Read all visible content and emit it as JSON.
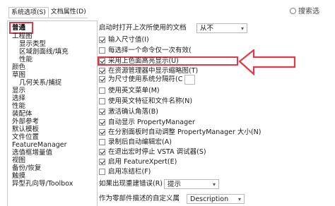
{
  "tabs": [
    {
      "label": "系统选项(S)"
    },
    {
      "label": "文档属性(D)"
    }
  ],
  "search": {
    "placeholder": "搜索选"
  },
  "sidebar": {
    "selected": "普通",
    "items": [
      {
        "label": "工程图",
        "level": 1
      },
      {
        "label": "显示类型",
        "level": 2
      },
      {
        "label": "区域剖面线/填充",
        "level": 2
      },
      {
        "label": "性能",
        "level": 2
      },
      {
        "label": "颜色",
        "level": 1
      },
      {
        "label": "草图",
        "level": 1
      },
      {
        "label": "几何关系/捕捉",
        "level": 2
      },
      {
        "label": "显示",
        "level": 1
      },
      {
        "label": "选择",
        "level": 1
      },
      {
        "label": "性能",
        "level": 1
      },
      {
        "label": "装配体",
        "level": 1
      },
      {
        "label": "外部参考",
        "level": 1
      },
      {
        "label": "默认模板",
        "level": 1
      },
      {
        "label": "文件位置",
        "level": 1
      },
      {
        "label": "FeatureManager",
        "level": 1
      },
      {
        "label": "选值框增量值",
        "level": 1
      },
      {
        "label": "视图",
        "level": 1
      },
      {
        "label": "备份/恢复",
        "level": 1
      },
      {
        "label": "触摸",
        "level": 1
      },
      {
        "label": "异型孔向导/Toolbox",
        "level": 1
      }
    ]
  },
  "settings": {
    "startup_label": "启动时打开上次所使用的文档",
    "startup_value": "从不",
    "options": [
      {
        "label": "输入尺寸值(I)",
        "checked": true
      },
      {
        "label": "每选择一个命令仅一次有效(",
        "checked": false
      },
      {
        "label": "采用上色面高亮显示(U)",
        "checked": true
      },
      {
        "label": "在资源管理器中显示缩略图(T)",
        "checked": true
      },
      {
        "label": "为尺寸使用系统分隔符(C",
        "checked": true
      },
      {
        "label": "使用英文菜单(M)",
        "checked": false
      },
      {
        "label": "使用英文特征和文件名称(N)",
        "checked": false
      },
      {
        "label": "激活确认角落(B)",
        "checked": true
      },
      {
        "label": "自动显示 PropertyManager",
        "checked": true
      },
      {
        "label": "在分割面板时自动调整 PropertyManager 大小(N)",
        "checked": true
      },
      {
        "label": "录制后自动编辑宏(A)",
        "checked": false
      },
      {
        "label": "在退出宏时停止 VSTA 调试器(S)",
        "checked": true
      },
      {
        "label": "启用 FeatureXpert(E)",
        "checked": true
      },
      {
        "label": "启用冻结栏(F)",
        "checked": false
      }
    ],
    "rebuild_error_label": "如果出现重建错误(R)",
    "rebuild_error_value": "提示",
    "custom_prop_label": "作为零部件描述的自定义属",
    "custom_prop_value": "Description"
  },
  "colors": {
    "highlight": "#e23a4b"
  }
}
